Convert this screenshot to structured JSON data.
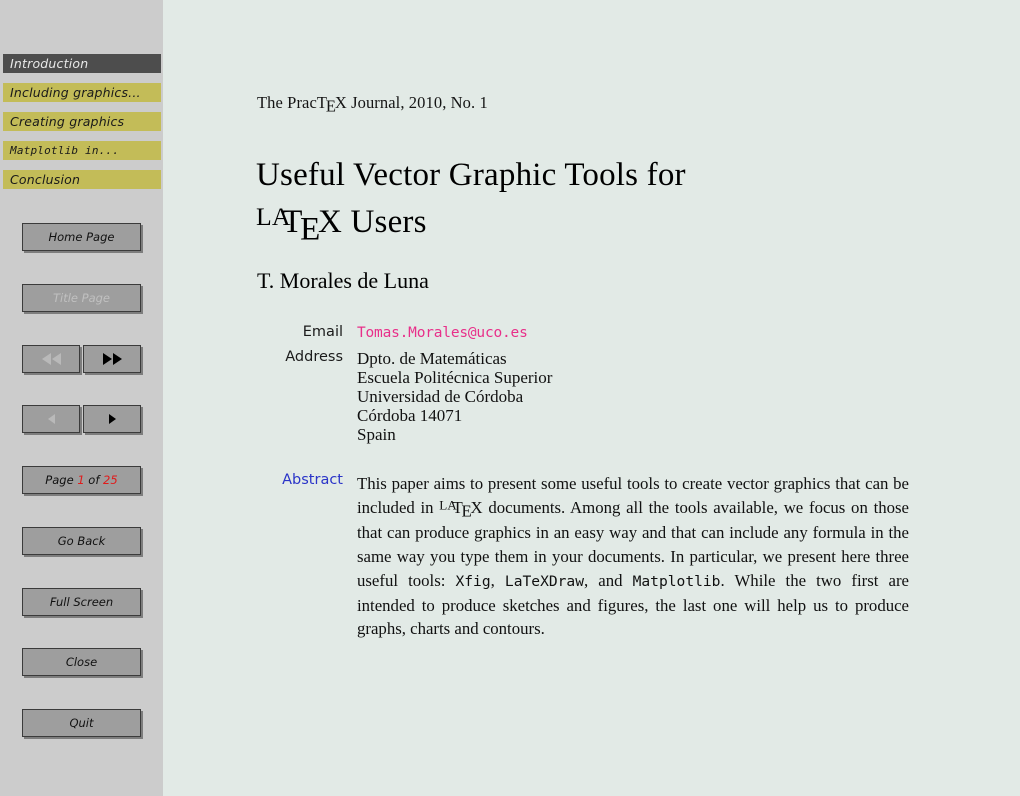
{
  "sidebar": {
    "nav_tabs": [
      {
        "label": "Introduction",
        "style": "active"
      },
      {
        "label": "Including graphics...",
        "style": "olive"
      },
      {
        "label": "Creating graphics",
        "style": "olive"
      },
      {
        "label": "Matplotlib in...",
        "style": "olive-mono"
      },
      {
        "label": "Conclusion",
        "style": "olive"
      }
    ],
    "buttons": {
      "home_page": "Home Page",
      "title_page": "Title Page",
      "go_back": "Go Back",
      "full_screen": "Full Screen",
      "close": "Close",
      "quit": "Quit"
    },
    "page_indicator": {
      "prefix": "Page",
      "current": "1",
      "middle": "of",
      "total": "25"
    },
    "nav_icons": {
      "first": "double-left-arrow-icon",
      "last": "double-right-arrow-icon",
      "prev": "left-arrow-icon",
      "next": "right-arrow-icon"
    },
    "colors": {
      "background": "#cccccc",
      "tab_olive": "#c3bc58",
      "tab_active": "#4d4d4d",
      "button_face": "#9e9e9e",
      "page_number_red": "#e01b1b"
    }
  },
  "document": {
    "journal_line_prefix": "The Prac",
    "journal_tex_t": "T",
    "journal_tex_e": "E",
    "journal_tex_x": "X",
    "journal_line_suffix": " Journal, 2010, No. 1",
    "title_line1": "Useful Vector Graphic Tools for",
    "title_latex_la": "LA",
    "title_latex_t": "T",
    "title_latex_e": "E",
    "title_latex_x": "X",
    "title_line2_suffix": " Users",
    "author": "T. Morales de Luna",
    "meta": {
      "email_label": "Email",
      "email_value": "Tomas.Morales@uco.es",
      "address_label": "Address",
      "address_lines": [
        "Dpto. de Matemáticas",
        "Escuela Politécnica Superior",
        "Universidad de Córdoba",
        "Córdoba 14071",
        "Spain"
      ],
      "abstract_label": "Abstract",
      "abstract_part1": "This paper aims to present some useful tools to create vector graphics that can be included in ",
      "abstract_latex_la": "LA",
      "abstract_latex_t": "T",
      "abstract_latex_e": "E",
      "abstract_latex_x": "X",
      "abstract_part2": " documents. Among all the tools available, we focus on those that can produce graphics in an easy way and that can include any formula in the same way you type them in your documents. In particular, we present here three useful tools: ",
      "abstract_tool1": "Xfig",
      "abstract_sep1": ", ",
      "abstract_tool2": "LaTeXDraw",
      "abstract_sep2": ", and ",
      "abstract_tool3": "Matplotlib",
      "abstract_part3": ". While the two first are intended to produce sketches and figures, the last one will help us to produce graphs, charts and contours."
    },
    "colors": {
      "background": "#e2eae6",
      "email_magenta": "#e8308a",
      "abstract_label_blue": "#2a34c8"
    }
  }
}
